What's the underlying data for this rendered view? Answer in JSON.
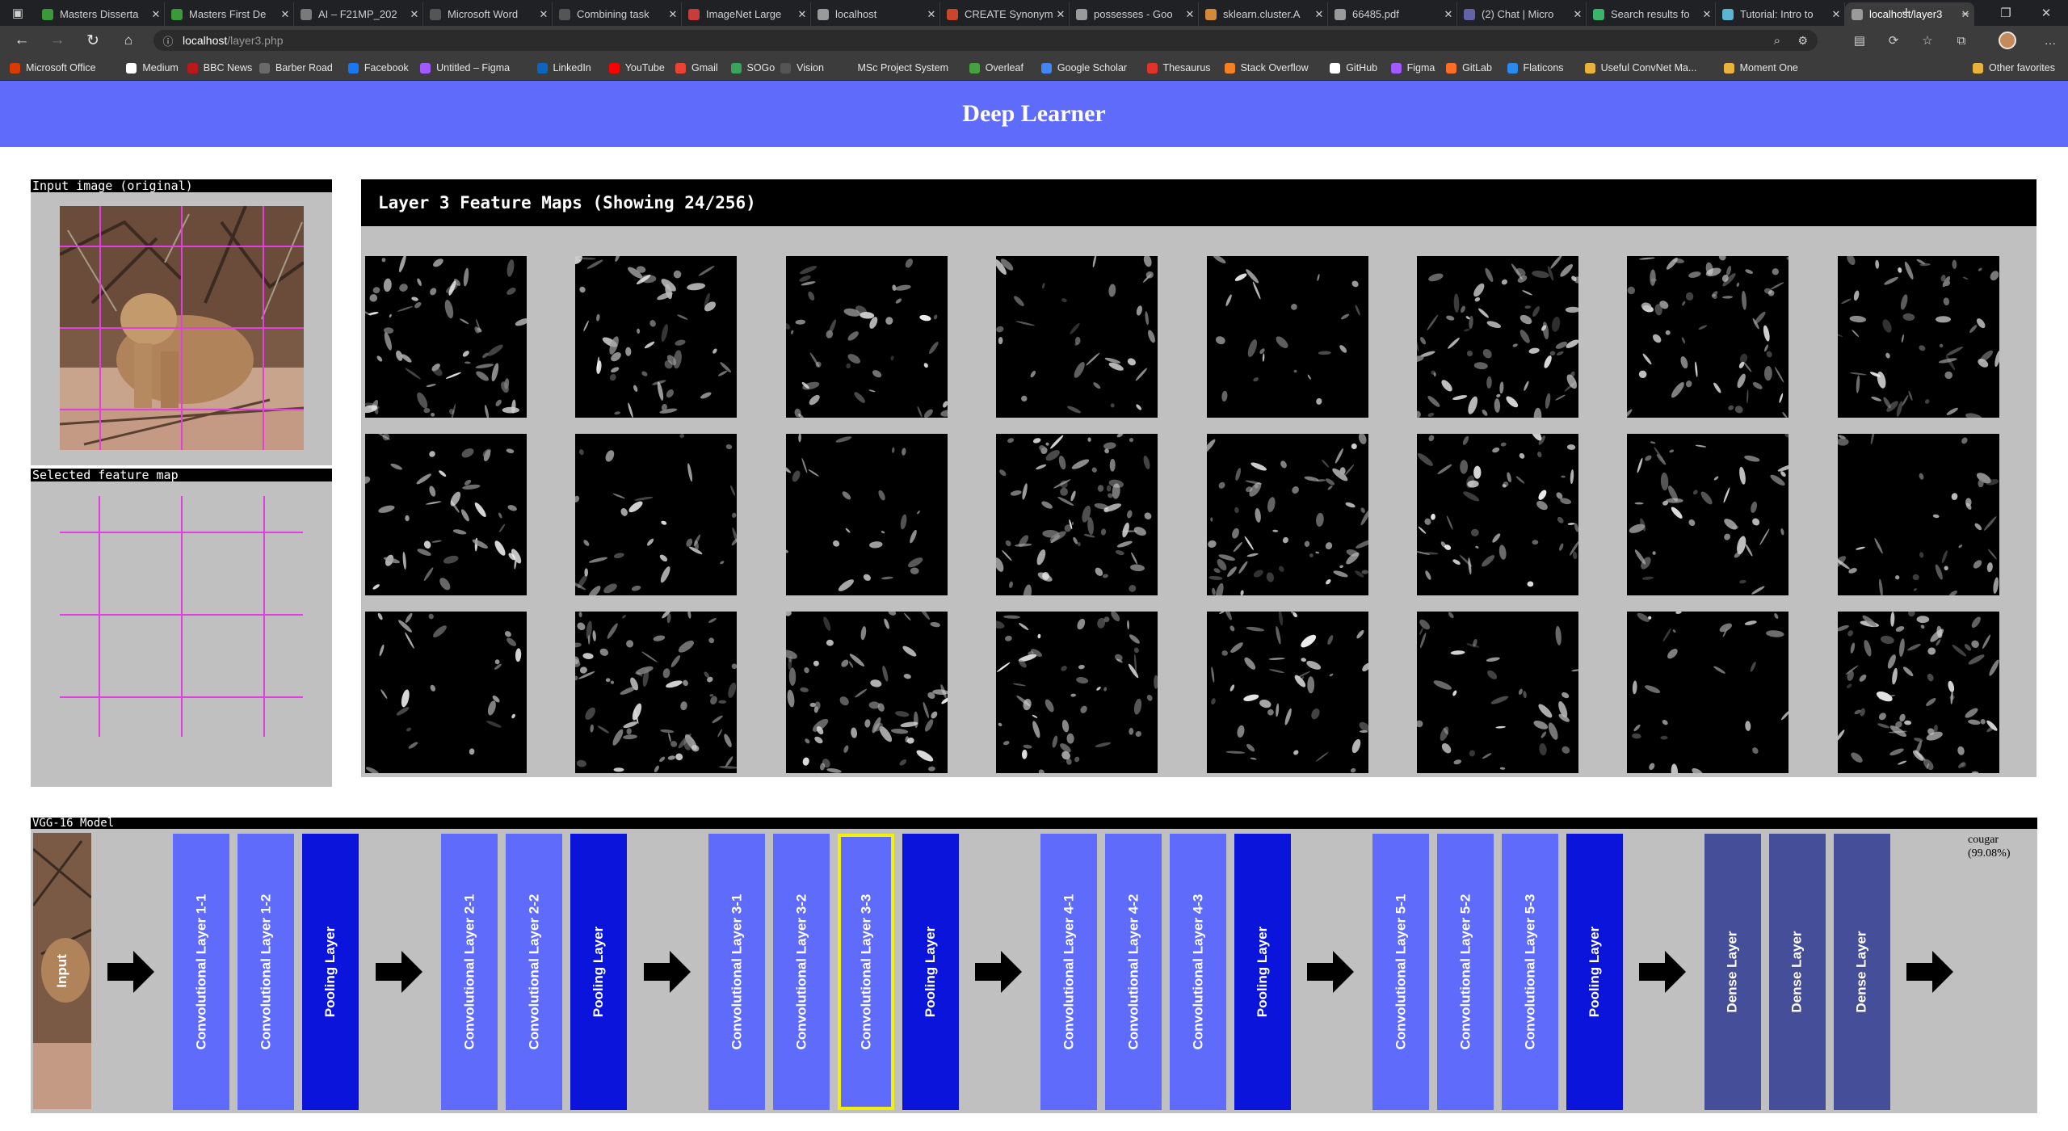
{
  "browser": {
    "tabs": [
      {
        "title": "Masters Disserta",
        "icon_color": "#3a9a3a"
      },
      {
        "title": "Masters First De",
        "icon_color": "#3a9a3a"
      },
      {
        "title": "AI – F21MP_202",
        "icon_color": "#7a7a7a"
      },
      {
        "title": "Microsoft Word",
        "icon_color": "#555555"
      },
      {
        "title": "Combining task",
        "icon_color": "#555555"
      },
      {
        "title": "ImageNet Large",
        "icon_color": "#c83c3c"
      },
      {
        "title": "localhost",
        "icon_color": "#9a9a9a"
      },
      {
        "title": "CREATE Synonym",
        "icon_color": "#c8462a"
      },
      {
        "title": "possesses - Goo",
        "icon_color": "#9a9a9a"
      },
      {
        "title": "sklearn.cluster.A",
        "icon_color": "#d28a3a"
      },
      {
        "title": "66485.pdf",
        "icon_color": "#9a9a9a"
      },
      {
        "title": "(2) Chat | Micro",
        "icon_color": "#6264a7"
      },
      {
        "title": "Search results fo",
        "icon_color": "#3ab46a"
      },
      {
        "title": "Tutorial: Intro to",
        "icon_color": "#5ab4d2"
      },
      {
        "title": "localhost/layer3",
        "icon_color": "#9a9a9a",
        "active": true
      }
    ],
    "new_tab": "+",
    "address": {
      "host": "localhost",
      "path": "/layer3.php"
    },
    "bookmarks": [
      {
        "label": "Microsoft Office",
        "icon_color": "#d83b01"
      },
      {
        "label": "Medium",
        "icon_color": "#ffffff"
      },
      {
        "label": "BBC News",
        "icon_color": "#bb1919"
      },
      {
        "label": "Barber Road",
        "icon_color": "#6a6a6a"
      },
      {
        "label": "Facebook",
        "icon_color": "#1877f2"
      },
      {
        "label": "Untitled – Figma",
        "icon_color": "#a259ff"
      },
      {
        "label": "LinkedIn",
        "icon_color": "#0a66c2"
      },
      {
        "label": "YouTube",
        "icon_color": "#ff0000"
      },
      {
        "label": "Gmail",
        "icon_color": "#ea4335"
      },
      {
        "label": "SOGo",
        "icon_color": "#3aa55a"
      },
      {
        "label": "Vision",
        "icon_color": "#555555"
      },
      {
        "label": "MSc Project System",
        "icon_color": "#3c3c3c"
      },
      {
        "label": "Overleaf",
        "icon_color": "#47a141"
      },
      {
        "label": "Google Scholar",
        "icon_color": "#4285f4"
      },
      {
        "label": "Thesaurus",
        "icon_color": "#e2332a"
      },
      {
        "label": "Stack Overflow",
        "icon_color": "#f48024"
      },
      {
        "label": "GitHub",
        "icon_color": "#ffffff"
      },
      {
        "label": "Figma",
        "icon_color": "#a259ff"
      },
      {
        "label": "GitLab",
        "icon_color": "#fc6d26"
      },
      {
        "label": "Flaticons",
        "icon_color": "#2a8af0"
      },
      {
        "label": "Useful ConvNet Ma...",
        "icon_color": "#e8b33a"
      },
      {
        "label": "Moment One",
        "icon_color": "#e8b33a"
      }
    ],
    "other_favorites": "Other favorites"
  },
  "page": {
    "title": "Deep Learner",
    "input_label": "Input image (original)",
    "selected_label": "Selected feature map",
    "feature_maps_title": "Layer 3 Feature Maps (Showing 24/256)",
    "feature_maps_count": 24,
    "model_label": "VGG-16 Model",
    "input_block_label": "Input",
    "layers": [
      {
        "label": "Convolutional Layer 1-1",
        "kind": "conv"
      },
      {
        "label": "Convolutional Layer 1-2",
        "kind": "conv"
      },
      {
        "label": "Pooling Layer",
        "kind": "pool"
      },
      {
        "label": "Convolutional Layer 2-1",
        "kind": "conv"
      },
      {
        "label": "Convolutional Layer 2-2",
        "kind": "conv"
      },
      {
        "label": "Pooling Layer",
        "kind": "pool"
      },
      {
        "label": "Convolutional Layer 3-1",
        "kind": "conv"
      },
      {
        "label": "Convolutional Layer 3-2",
        "kind": "conv"
      },
      {
        "label": "Convolutional Layer 3-3",
        "kind": "conv",
        "selected": true
      },
      {
        "label": "Pooling Layer",
        "kind": "pool"
      },
      {
        "label": "Convolutional Layer 4-1",
        "kind": "conv"
      },
      {
        "label": "Convolutional Layer 4-2",
        "kind": "conv"
      },
      {
        "label": "Convolutional Layer 4-3",
        "kind": "conv"
      },
      {
        "label": "Pooling Layer",
        "kind": "pool"
      },
      {
        "label": "Convolutional Layer 5-1",
        "kind": "conv"
      },
      {
        "label": "Convolutional Layer 5-2",
        "kind": "conv"
      },
      {
        "label": "Convolutional Layer 5-3",
        "kind": "conv"
      },
      {
        "label": "Pooling Layer",
        "kind": "pool"
      },
      {
        "label": "Dense Layer",
        "kind": "dense"
      },
      {
        "label": "Dense Layer",
        "kind": "dense"
      },
      {
        "label": "Dense Layer",
        "kind": "dense"
      }
    ],
    "prediction": {
      "label": "cougar",
      "confidence": "(99.08%)"
    },
    "colors": {
      "header": "#5f6bfb",
      "conv": "#5f6bfb",
      "pool": "#0a14db",
      "dense": "#444e99",
      "selected_border": "#f0f00a",
      "grid_lines": "#e040e0",
      "panel_bg": "#c0c0c0"
    }
  }
}
